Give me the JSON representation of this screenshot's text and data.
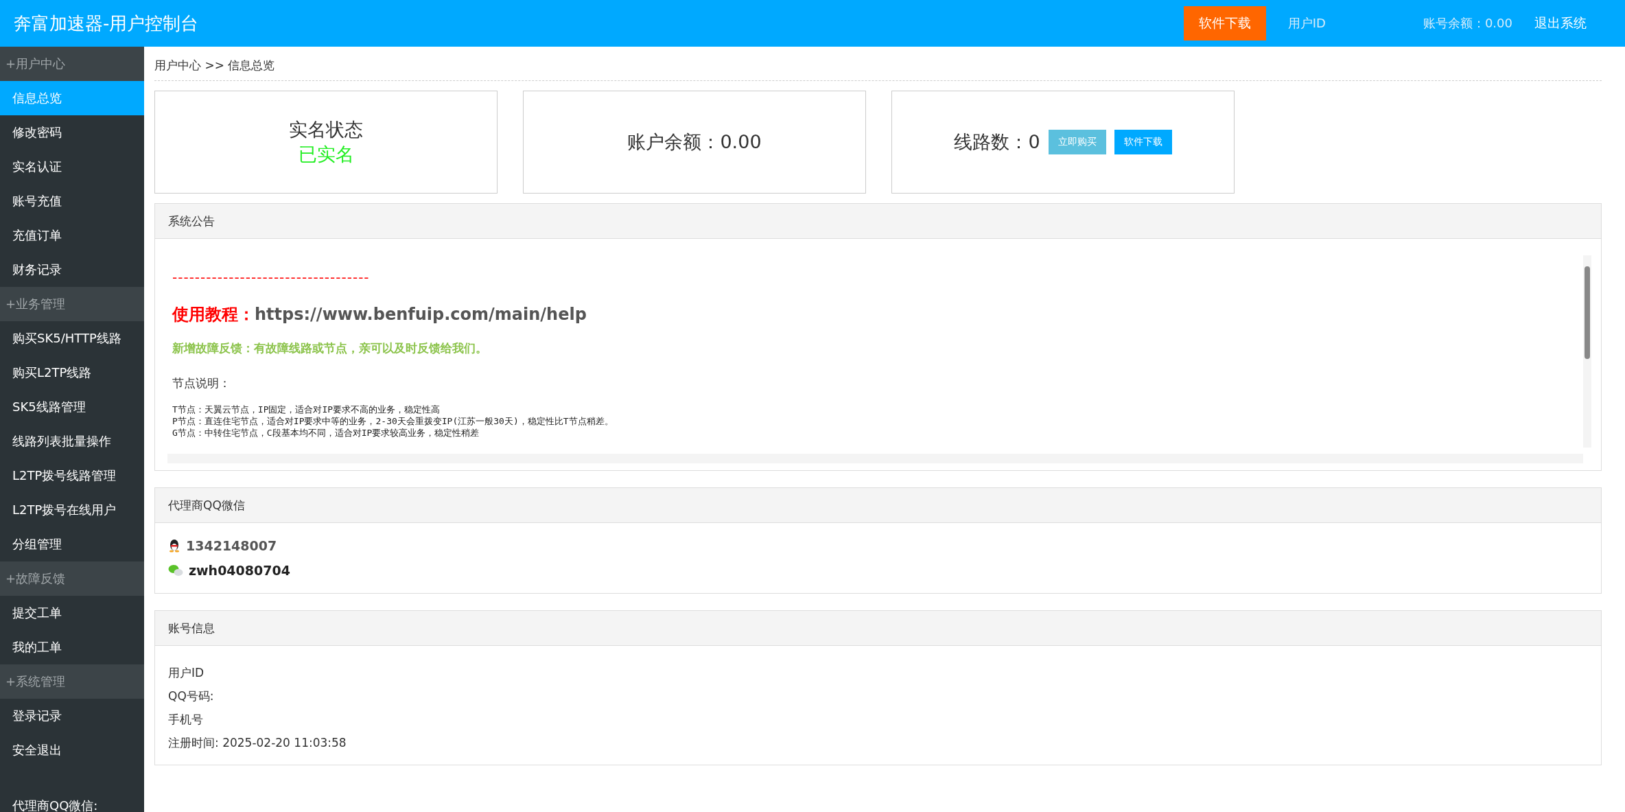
{
  "header": {
    "title": "奔富加速器-用户控制台",
    "download_button": "软件下载",
    "user_id_label": "用户ID",
    "balance": "账号余额：0.00",
    "logout": "退出系统"
  },
  "sidebar": {
    "groups": [
      {
        "title": "+用户中心",
        "items": [
          {
            "label": "信息总览",
            "selected": true
          },
          {
            "label": "修改密码",
            "selected": false
          },
          {
            "label": "实名认证",
            "selected": false
          },
          {
            "label": "账号充值",
            "selected": false
          },
          {
            "label": "充值订单",
            "selected": false
          },
          {
            "label": "财务记录",
            "selected": false
          }
        ]
      },
      {
        "title": "+业务管理",
        "items": [
          {
            "label": "购买SK5/HTTP线路",
            "selected": false
          },
          {
            "label": "购买L2TP线路",
            "selected": false
          },
          {
            "label": "SK5线路管理",
            "selected": false
          },
          {
            "label": "线路列表批量操作",
            "selected": false
          },
          {
            "label": "L2TP拨号线路管理",
            "selected": false
          },
          {
            "label": "L2TP拨号在线用户",
            "selected": false
          },
          {
            "label": "分组管理",
            "selected": false
          }
        ]
      },
      {
        "title": "+故障反馈",
        "items": [
          {
            "label": "提交工单",
            "selected": false
          },
          {
            "label": "我的工单",
            "selected": false
          }
        ]
      },
      {
        "title": "+系统管理",
        "items": [
          {
            "label": "登录记录",
            "selected": false
          },
          {
            "label": "安全退出",
            "selected": false
          }
        ]
      }
    ],
    "footer": "代理商QQ微信:"
  },
  "breadcrumb": "用户中心 >> 信息总览",
  "cards": [
    {
      "kind": "status",
      "title": "实名状态",
      "value": "已实名"
    },
    {
      "kind": "balance",
      "title": "账户余额：0.00"
    },
    {
      "kind": "lines",
      "title": "线路数：0",
      "buttons": [
        "立即购买",
        "软件下载"
      ]
    }
  ],
  "notice": {
    "title": "系统公告",
    "divider": "-----------------------------------",
    "tutorial_label": "使用教程：",
    "tutorial_url": "https://www.benfuip.com/main/help",
    "feedback": "新增故障反馈：有故障线路或节点，亲可以及时反馈给我们。",
    "nodes_title": "节点说明：",
    "nodes": [
      "T节点：天翼云节点，IP固定，适合对IP要求不高的业务，稳定性高",
      "P节点：直连住宅节点，适合对IP要求中等的业务，2-30天会重拨变IP(江苏一般30天)，稳定性比T节点稍差。",
      "G节点：中转住宅节点，C段基本均不同，适合对IP要求较高业务，稳定性稍差"
    ]
  },
  "agent": {
    "title": "代理商QQ微信",
    "contacts": [
      {
        "kind": "qq",
        "value": "1342148007"
      },
      {
        "kind": "wechat",
        "value": "zwh04080704"
      }
    ]
  },
  "account": {
    "title": "账号信息",
    "fields": [
      "用户ID",
      "QQ号码:",
      "手机号",
      "注册时间: 2025-02-20 11:03:58"
    ]
  }
}
